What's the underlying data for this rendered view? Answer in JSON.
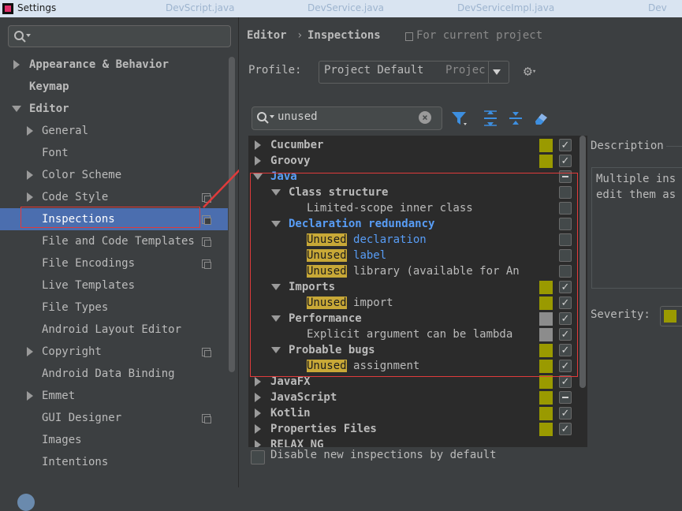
{
  "window": {
    "title": "Settings",
    "bg_tabs": [
      "DevScript.java",
      "DevService.java",
      "DevServiceImpl.java",
      "Dev"
    ]
  },
  "sidebar": {
    "search_placeholder": "",
    "items": [
      {
        "label": "Appearance & Behavior",
        "bold": true,
        "arrow": "right",
        "level": 0
      },
      {
        "label": "Keymap",
        "bold": true,
        "arrow": "",
        "level": 0
      },
      {
        "label": "Editor",
        "bold": true,
        "arrow": "down",
        "level": 0
      },
      {
        "label": "General",
        "arrow": "right",
        "level": 1
      },
      {
        "label": "Font",
        "arrow": "",
        "level": 1
      },
      {
        "label": "Color Scheme",
        "arrow": "right",
        "level": 1
      },
      {
        "label": "Code Style",
        "arrow": "right",
        "level": 1,
        "project": true
      },
      {
        "label": "Inspections",
        "arrow": "",
        "level": 1,
        "project": true,
        "selected": true
      },
      {
        "label": "File and Code Templates",
        "arrow": "",
        "level": 1,
        "project": true
      },
      {
        "label": "File Encodings",
        "arrow": "",
        "level": 1,
        "project": true
      },
      {
        "label": "Live Templates",
        "arrow": "",
        "level": 1
      },
      {
        "label": "File Types",
        "arrow": "",
        "level": 1
      },
      {
        "label": "Android Layout Editor",
        "arrow": "",
        "level": 1
      },
      {
        "label": "Copyright",
        "arrow": "right",
        "level": 1,
        "project": true
      },
      {
        "label": "Android Data Binding",
        "arrow": "",
        "level": 1
      },
      {
        "label": "Emmet",
        "arrow": "right",
        "level": 1
      },
      {
        "label": "GUI Designer",
        "arrow": "",
        "level": 1,
        "project": true
      },
      {
        "label": "Images",
        "arrow": "",
        "level": 1
      },
      {
        "label": "Intentions",
        "arrow": "",
        "level": 1
      }
    ]
  },
  "header": {
    "crumb_parent": "Editor",
    "crumb_sep": "›",
    "crumb_current": "Inspections",
    "scope": "For current project"
  },
  "profile": {
    "label": "Profile:",
    "value": "Project Default",
    "value_suffix": "Projec"
  },
  "filter": {
    "value": "unused"
  },
  "colors": {
    "selection": "#4b6eaf",
    "highlight": "#c8a837",
    "severity_warning": "#9a9a00",
    "severity_weak": "#8c8c8c",
    "annotation_red": "#e03b3b"
  },
  "tree": [
    {
      "label": "Cucumber",
      "bold": true,
      "arrow": "right",
      "indent": 0,
      "sev": "warning",
      "check": "checked"
    },
    {
      "label": "Groovy",
      "bold": true,
      "arrow": "right",
      "indent": 0,
      "sev": "warning",
      "check": "checked"
    },
    {
      "label": "Java",
      "bold": true,
      "blue": true,
      "arrow": "down",
      "indent": 0,
      "sev": "",
      "check": "dash"
    },
    {
      "label": "Class structure",
      "bold": true,
      "arrow": "down",
      "indent": 1,
      "sev": "",
      "check": "empty"
    },
    {
      "label": "Limited-scope inner class",
      "arrow": "",
      "indent": 2,
      "sev": "",
      "check": "empty"
    },
    {
      "label": "Declaration redundancy",
      "bold": true,
      "blue": true,
      "arrow": "down",
      "indent": 1,
      "sev": "",
      "check": "empty"
    },
    {
      "hl": "Unused",
      "label": "declaration",
      "blue": true,
      "arrow": "",
      "indent": 2,
      "sev": "",
      "check": "empty"
    },
    {
      "hl": "Unused",
      "label": "label",
      "blue": true,
      "arrow": "",
      "indent": 2,
      "sev": "",
      "check": "empty"
    },
    {
      "hl": "Unused",
      "label": "library (available for An",
      "arrow": "",
      "indent": 2,
      "sev": "",
      "check": "empty"
    },
    {
      "label": "Imports",
      "bold": true,
      "arrow": "down",
      "indent": 1,
      "sev": "warning",
      "check": "checked"
    },
    {
      "hl": "Unused",
      "label": "import",
      "arrow": "",
      "indent": 2,
      "sev": "warning",
      "check": "checked"
    },
    {
      "label": "Performance",
      "bold": true,
      "arrow": "down",
      "indent": 1,
      "sev": "weak",
      "check": "checked"
    },
    {
      "label": "Explicit argument can be lambda",
      "arrow": "",
      "indent": 2,
      "sev": "weak",
      "check": "checked"
    },
    {
      "label": "Probable bugs",
      "bold": true,
      "arrow": "down",
      "indent": 1,
      "sev": "warning",
      "check": "checked"
    },
    {
      "hl": "Unused",
      "label": "assignment",
      "arrow": "",
      "indent": 2,
      "sev": "warning",
      "check": "checked"
    },
    {
      "label": "JavaFX",
      "bold": true,
      "arrow": "right",
      "indent": 0,
      "sev": "warning",
      "check": "checked"
    },
    {
      "label": "JavaScript",
      "bold": true,
      "arrow": "right",
      "indent": 0,
      "sev": "warning",
      "check": "dash"
    },
    {
      "label": "Kotlin",
      "bold": true,
      "arrow": "right",
      "indent": 0,
      "sev": "warning",
      "check": "checked"
    },
    {
      "label": "Properties Files",
      "bold": true,
      "arrow": "right",
      "indent": 0,
      "sev": "warning",
      "check": "checked"
    },
    {
      "label": "RELAX NG",
      "bold": true,
      "arrow": "right",
      "indent": 0,
      "sev": "",
      "check": ""
    }
  ],
  "description": {
    "title": "Description",
    "lines": [
      "Multiple ins",
      "edit them as"
    ]
  },
  "severity": {
    "label": "Severity:"
  },
  "disable_new": {
    "label": "Disable new inspections by default"
  }
}
